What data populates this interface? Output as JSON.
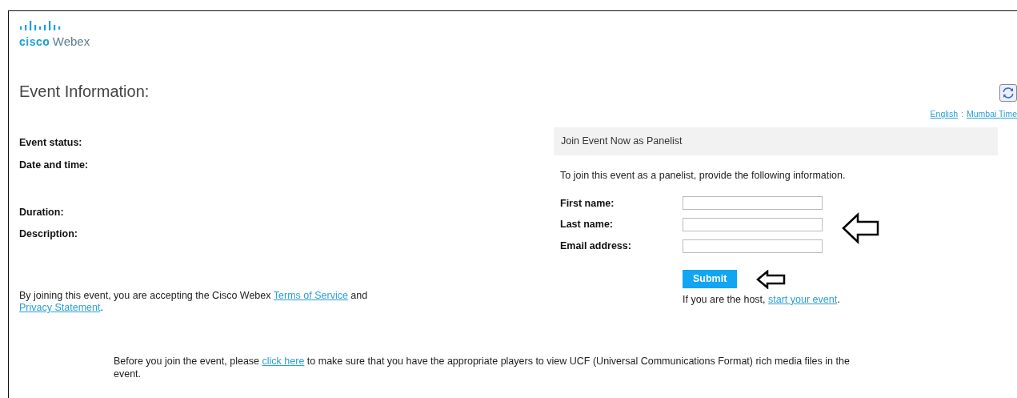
{
  "logo": {
    "brand": "cisco",
    "product": "Webex"
  },
  "title": "Event Information:",
  "locale_links": [
    {
      "label": "English"
    },
    {
      "label": "Mumbai Time"
    }
  ],
  "locale_separator": ":",
  "event_fields": [
    {
      "label": "Event status:"
    },
    {
      "label": "Date and time:"
    },
    {
      "label": "Duration:"
    },
    {
      "label": "Description:"
    }
  ],
  "terms": [
    {
      "kind": "text",
      "text": "By joining this event, you are accepting the Cisco Webex "
    },
    {
      "kind": "link",
      "text": "Terms of Service"
    },
    {
      "kind": "text",
      "text": " and "
    },
    {
      "kind": "link",
      "text": "Privacy Statement"
    },
    {
      "kind": "text",
      "text": "."
    }
  ],
  "join_panel": {
    "header": "Join Event Now as Panelist",
    "instruction": "To join this event as a panelist, provide the following information.",
    "fields": [
      {
        "label": "First name:"
      },
      {
        "label": "Last name:"
      },
      {
        "label": "Email address:"
      }
    ],
    "submit": "Submit",
    "host_note": [
      {
        "kind": "text",
        "text": "If you are the host, "
      },
      {
        "kind": "link",
        "text": "start your event"
      },
      {
        "kind": "text",
        "text": "."
      }
    ]
  },
  "players_note": [
    {
      "kind": "text",
      "text": "Before you join the event, please "
    },
    {
      "kind": "link",
      "text": "click here"
    },
    {
      "kind": "text",
      "text": " to make sure that you have the appropriate players to view UCF (Universal Communications Format) rich media files in the event."
    }
  ]
}
